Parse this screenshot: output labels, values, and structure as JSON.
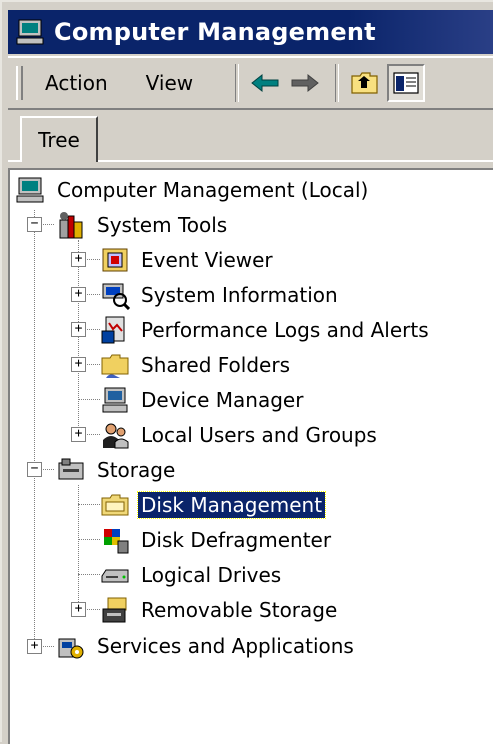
{
  "window": {
    "title": "Computer Management",
    "title_icon": "computer-management-icon"
  },
  "menu": {
    "action": "Action",
    "view": "View"
  },
  "toolbar": {
    "buttons": [
      "back-arrow-icon",
      "forward-arrow-icon",
      "up-folder-icon",
      "show-hide-tree-icon"
    ]
  },
  "tabs": {
    "tree": "Tree"
  },
  "tree": {
    "root": "Computer Management (Local)",
    "system_tools": {
      "label": "System Tools",
      "children": {
        "event_viewer": "Event Viewer",
        "system_information": "System Information",
        "performance_logs": "Performance Logs and Alerts",
        "shared_folders": "Shared Folders",
        "device_manager": "Device Manager",
        "local_users": "Local Users and Groups"
      }
    },
    "storage": {
      "label": "Storage",
      "children": {
        "disk_management": "Disk Management",
        "disk_defragmenter": "Disk Defragmenter",
        "logical_drives": "Logical Drives",
        "removable_storage": "Removable Storage"
      }
    },
    "services": {
      "label": "Services and Applications"
    },
    "selected": "Disk Management"
  },
  "colors": {
    "titlebar": "#0a246a",
    "selection": "#0a246a",
    "chrome": "#d4d0c8"
  }
}
